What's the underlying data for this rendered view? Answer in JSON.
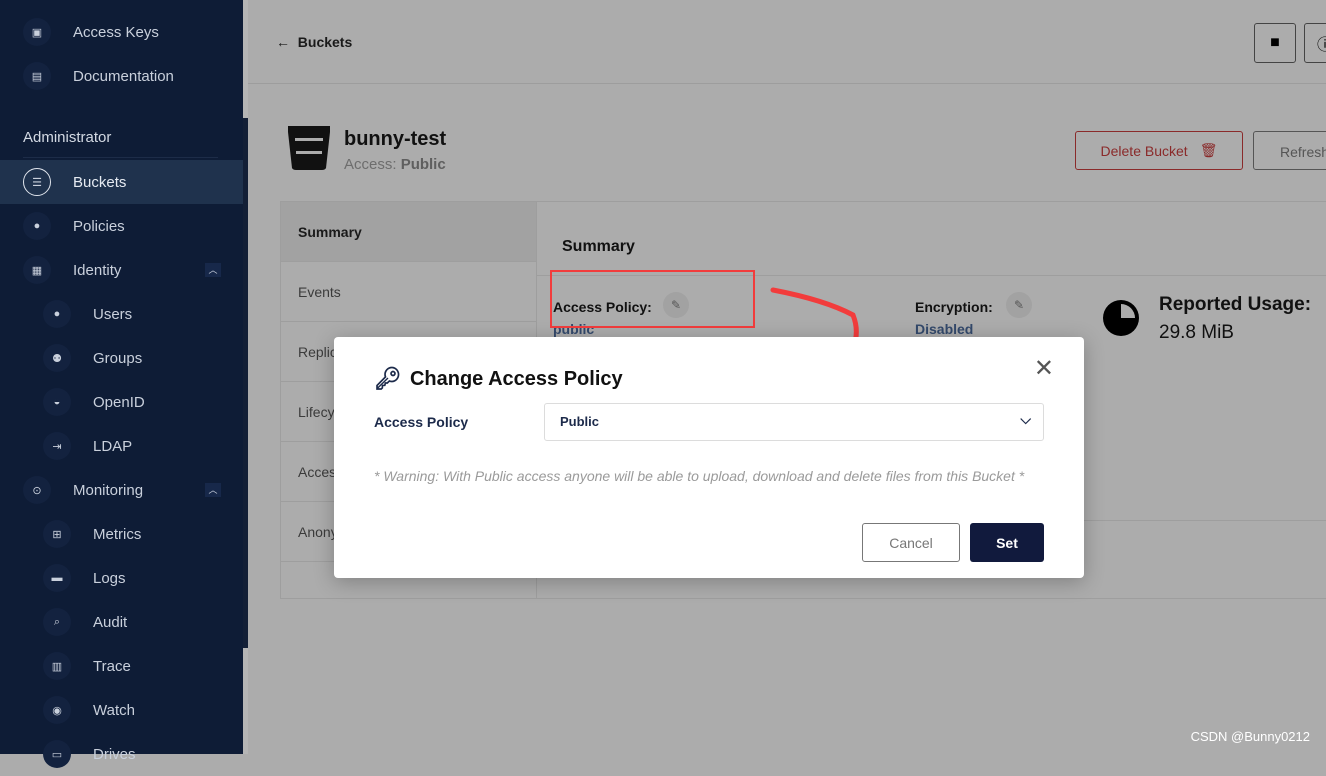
{
  "sidebar": {
    "top_items": [
      {
        "label": "Access Keys",
        "icon": "access-keys-icon"
      },
      {
        "label": "Documentation",
        "icon": "documentation-icon"
      }
    ],
    "section": "Administrator",
    "items": [
      {
        "label": "Buckets",
        "active": true
      },
      {
        "label": "Policies"
      },
      {
        "label": "Identity",
        "expanded": true
      },
      {
        "label": "Users"
      },
      {
        "label": "Groups"
      },
      {
        "label": "OpenID"
      },
      {
        "label": "LDAP"
      },
      {
        "label": "Monitoring",
        "expanded": true
      },
      {
        "label": "Metrics"
      },
      {
        "label": "Logs"
      },
      {
        "label": "Audit"
      },
      {
        "label": "Trace"
      },
      {
        "label": "Watch"
      },
      {
        "label": "Drives"
      }
    ]
  },
  "header": {
    "back_label": "Buckets"
  },
  "bucket": {
    "name": "bunny-test",
    "access_label": "Access:",
    "access_value": "Public",
    "delete_label": "Delete Bucket",
    "refresh_label": "Refresh"
  },
  "tabs": [
    "Summary",
    "Events",
    "Replication",
    "Lifecycle",
    "Access",
    "Anonymous"
  ],
  "summary": {
    "heading": "Summary",
    "access_policy_label": "Access Policy:",
    "access_policy_value": "public",
    "encryption_label": "Encryption:",
    "encryption_value": "Disabled",
    "usage_label": "Reported Usage:",
    "usage_value": "29.8 MiB"
  },
  "modal": {
    "title": "Change Access Policy",
    "field_label": "Access Policy",
    "selected": "Public",
    "warning": "* Warning: With Public access anyone will be able to upload, download and delete files from this Bucket *",
    "cancel": "Cancel",
    "set": "Set"
  },
  "annotation_color": "#f23c3c",
  "watermark": "CSDN @Bunny0212"
}
